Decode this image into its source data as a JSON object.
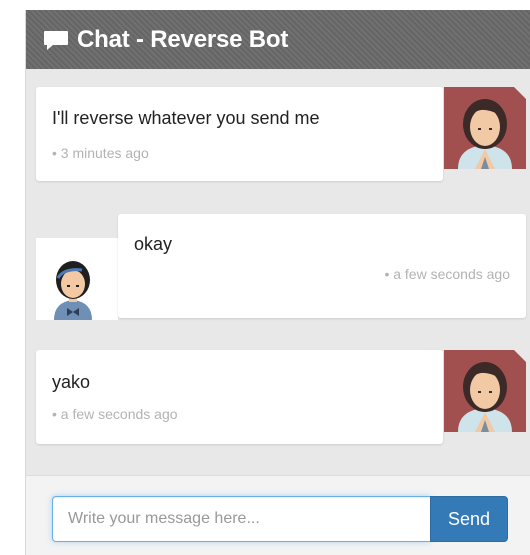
{
  "header": {
    "title": "Chat - Reverse Bot",
    "icon": "speech-bubble-icon"
  },
  "messages": [
    {
      "sender": "bot",
      "text": "I'll reverse whatever you send me",
      "time": "• 3 minutes ago"
    },
    {
      "sender": "user",
      "text": "okay",
      "time": "• a few seconds ago"
    },
    {
      "sender": "bot",
      "text": "yako",
      "time": "• a few seconds ago"
    }
  ],
  "composer": {
    "placeholder": "Write your message here...",
    "value": "",
    "send_label": "Send"
  },
  "colors": {
    "header_bg": "#696969",
    "send_button": "#337ab7",
    "bot_avatar_bg": "#a14f4f",
    "input_focus": "#66afe9"
  }
}
